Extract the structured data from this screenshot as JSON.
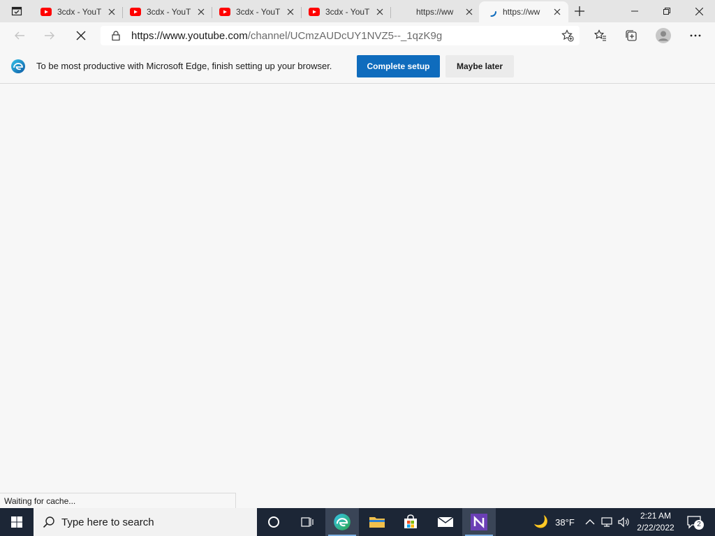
{
  "browser": {
    "tabs": [
      {
        "title": "3cdx - YouT",
        "favicon": "youtube-icon"
      },
      {
        "title": "3cdx - YouT",
        "favicon": "youtube-icon"
      },
      {
        "title": "3cdx - YouT",
        "favicon": "youtube-icon"
      },
      {
        "title": "3cdx - YouT",
        "favicon": "youtube-icon"
      },
      {
        "title": "https://ww",
        "favicon": "none"
      },
      {
        "title": "https://ww",
        "favicon": "loading-spinner-icon",
        "active": true
      }
    ],
    "address": {
      "host": "https://www.youtube.com",
      "path": "/channel/UCmzAUDcUY1NVZ5--_1qzK9g"
    }
  },
  "infobar": {
    "message": "To be most productive with Microsoft Edge, finish setting up your browser.",
    "primary_label": "Complete setup",
    "secondary_label": "Maybe later"
  },
  "status": {
    "text": "Waiting for cache..."
  },
  "taskbar": {
    "search_placeholder": "Type here to search",
    "weather": "38°F",
    "time": "2:21 AM",
    "date": "2/22/2022",
    "notification_count": "2"
  },
  "colors": {
    "accent": "#0f6cbd",
    "taskbar": "#1c2636",
    "youtube_red": "#ff0000"
  }
}
